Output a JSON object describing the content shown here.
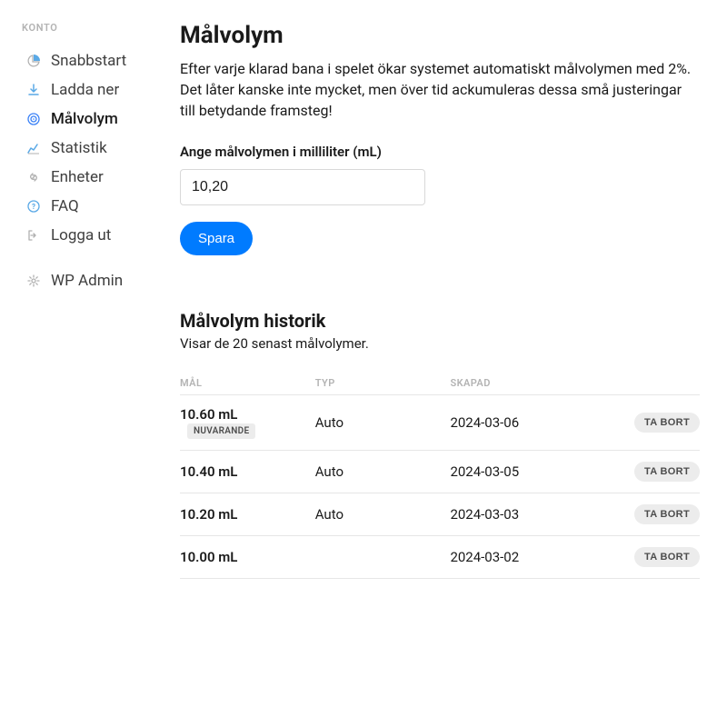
{
  "sidebar": {
    "heading": "KONTO",
    "items": [
      {
        "label": "Snabbstart",
        "active": false
      },
      {
        "label": "Ladda ner",
        "active": false
      },
      {
        "label": "Målvolym",
        "active": true
      },
      {
        "label": "Statistik",
        "active": false
      },
      {
        "label": "Enheter",
        "active": false
      },
      {
        "label": "FAQ",
        "active": false
      },
      {
        "label": "Logga ut",
        "active": false
      }
    ],
    "admin_label": "WP Admin"
  },
  "page": {
    "title": "Målvolym",
    "description": "Efter varje klarad bana i spelet ökar systemet automatiskt målvolymen med 2%. Det låter kanske inte mycket, men över tid ackumuleras dessa små justeringar till betydande framsteg!",
    "form_label": "Ange målvolymen i milliliter (mL)",
    "input_value": "10,20",
    "save_label": "Spara"
  },
  "history": {
    "title": "Målvolym historik",
    "subtext": "Visar de 20 senast målvolymer.",
    "columns": {
      "mal": "MÅL",
      "typ": "TYP",
      "created": "SKAPAD"
    },
    "badge_current": "NUVARANDE",
    "delete_label": "TA BORT",
    "rows": [
      {
        "mal": "10.60 mL",
        "typ": "Auto",
        "created": "2024-03-06",
        "current": true
      },
      {
        "mal": "10.40 mL",
        "typ": "Auto",
        "created": "2024-03-05",
        "current": false
      },
      {
        "mal": "10.20 mL",
        "typ": "Auto",
        "created": "2024-03-03",
        "current": false
      },
      {
        "mal": "10.00 mL",
        "typ": "",
        "created": "2024-03-02",
        "current": false
      }
    ]
  }
}
